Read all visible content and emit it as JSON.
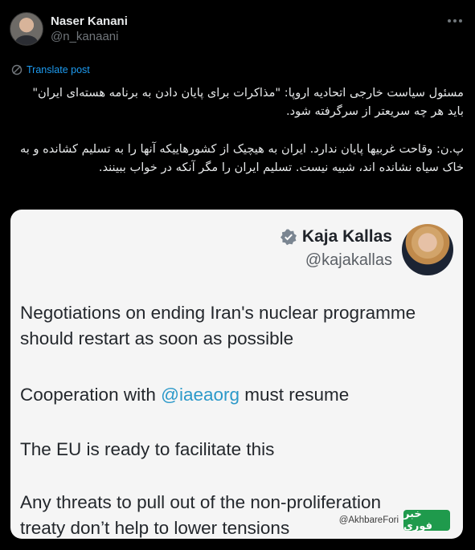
{
  "post": {
    "author_name": "Naser Kanani",
    "author_handle": "@n_kanaani",
    "translate_label": "Translate post",
    "body_paragraph_1": "مسئول سیاست خارجی اتحادیه اروپا: \"مذاکرات برای پایان دادن به برنامه هسته‌ای ایران\" باید هر چه سریعتر از سرگرفته شود.",
    "body_paragraph_2": "پ.ن: وقاحت غربیها پایان ندارد. ایران به هیچیک از کشورهاییکه آنها را به تسلیم کشانده و به خاک سیاه نشانده اند، شبیه نیست. تسلیم ایران را مگر آنکه در خواب ببینند."
  },
  "media": {
    "quoted_name": "Kaja Kallas",
    "quoted_handle": "@kajakallas",
    "line_1a": "Negotiations on ending Iran's nuclear programme",
    "line_1b": "should restart as soon as possible",
    "line_2_prefix": "Cooperation with ",
    "line_2_mention": "@iaeaorg",
    "line_2_suffix": " must resume",
    "line_3": "The EU is ready to facilitate this",
    "line_4a": "Any threats to pull out of the non-proliferation",
    "line_4b": "treaty don’t help to lower tensions",
    "watermark_handle": "@AkhbareFori",
    "watermark_logo": "خبر فوری"
  },
  "colors": {
    "background": "#000000",
    "link": "#1d9bf0",
    "mention": "#2c99c9",
    "watermark_green": "#1f9a4c"
  },
  "icons": [
    "more-icon",
    "translate-icon",
    "verified-icon"
  ]
}
